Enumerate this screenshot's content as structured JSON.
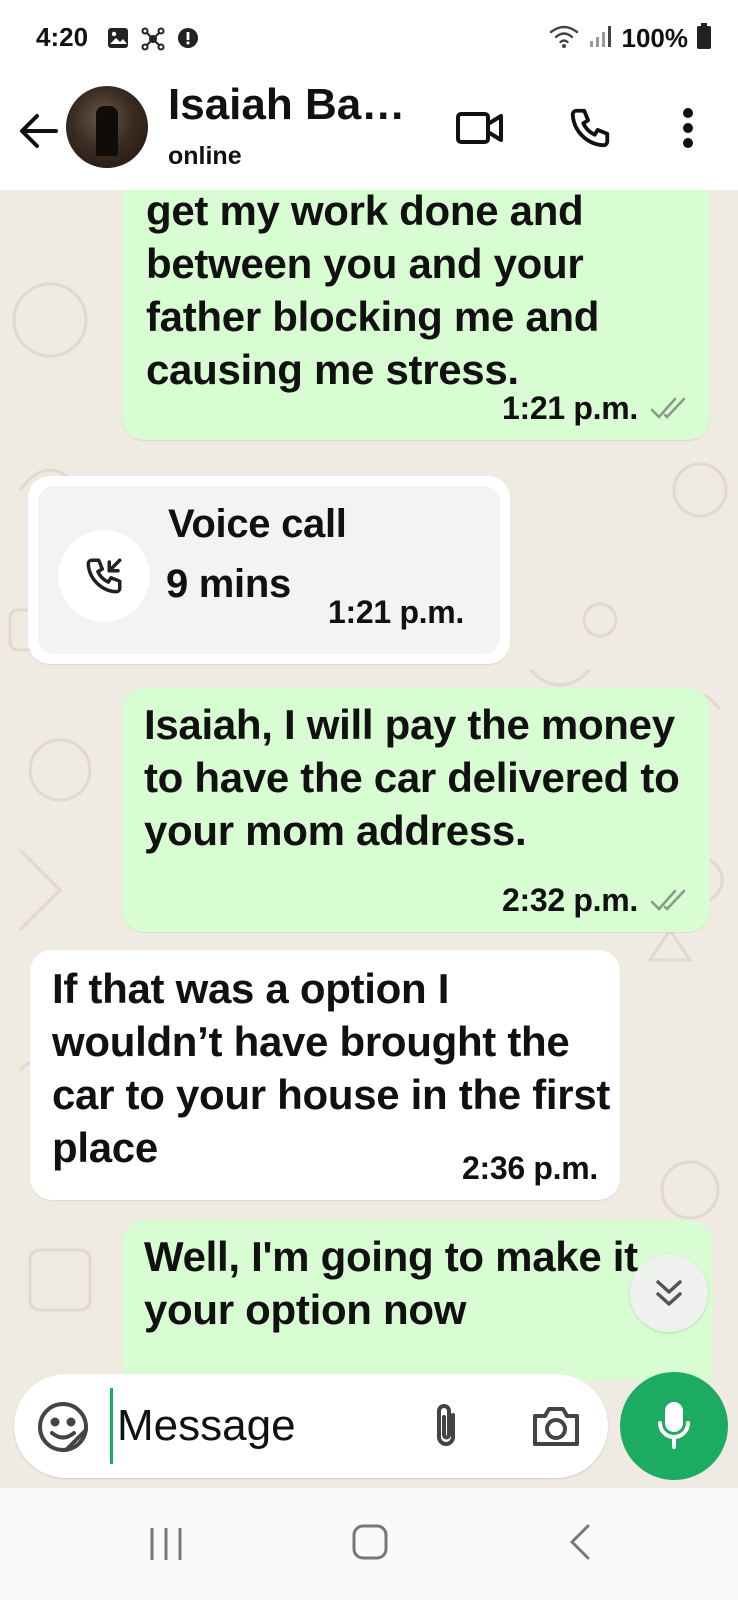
{
  "status_bar": {
    "time": "4:20",
    "battery": "100%",
    "left_icons": [
      "gallery-icon",
      "network-icon",
      "alert-icon"
    ],
    "right_icons": [
      "wifi-icon",
      "signal-icon",
      "battery-icon"
    ]
  },
  "header": {
    "contact_name": "Isaiah Ba…",
    "status": "online",
    "actions": [
      "video-call-icon",
      "phone-icon",
      "more-vert-icon"
    ]
  },
  "messages": [
    {
      "direction": "out",
      "text": "get my work done and between you and your father blocking me and causing me stress.",
      "time": "1:21 p.m.",
      "read": true
    },
    {
      "type": "call",
      "direction": "in",
      "title": "Voice call",
      "duration": "9 mins",
      "time": "1:21 p.m."
    },
    {
      "direction": "out",
      "text": "Isaiah, I will pay the money to have the car delivered to your mom address.",
      "time": "2:32 p.m.",
      "read": true
    },
    {
      "direction": "in",
      "text": "If that was a option I wouldn’t have brought the car to your house in the first place",
      "time": "2:36 p.m."
    },
    {
      "direction": "out",
      "text": "Well, I'm going to  make it your option now"
    }
  ],
  "composer": {
    "placeholder": "Message",
    "icons": [
      "sticker-icon",
      "attachment-icon",
      "camera-icon",
      "microphone-icon"
    ]
  },
  "colors": {
    "outgoing_bubble": "#d9fdd3",
    "incoming_bubble": "#ffffff",
    "chat_background": "#efeae2",
    "accent": "#1daa61"
  }
}
